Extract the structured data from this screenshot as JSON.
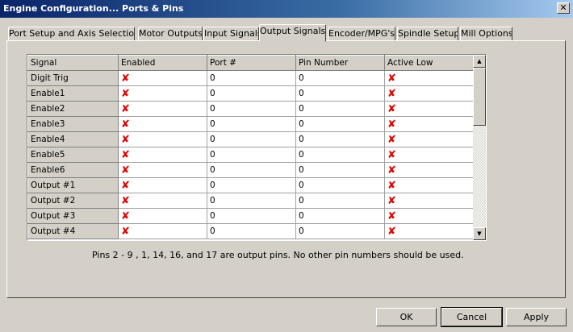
{
  "window": {
    "title": "Engine Configuration... Ports & Pins",
    "close_glyph": "✕"
  },
  "tabs": [
    {
      "label": "Port Setup and Axis Selection",
      "active": false
    },
    {
      "label": "Motor Outputs",
      "active": false
    },
    {
      "label": "Input Signals",
      "active": false
    },
    {
      "label": "Output Signals",
      "active": true
    },
    {
      "label": "Encoder/MPG's",
      "active": false
    },
    {
      "label": "Spindle Setup",
      "active": false
    },
    {
      "label": "Mill Options",
      "active": false
    }
  ],
  "grid": {
    "columns": [
      "Signal",
      "Enabled",
      "Port #",
      "Pin Number",
      "Active Low"
    ],
    "rows": [
      {
        "signal": "Digit  Trig",
        "enabled": "✘",
        "port": "0",
        "pin": "0",
        "active_low": "✘"
      },
      {
        "signal": "Enable1",
        "enabled": "✘",
        "port": "0",
        "pin": "0",
        "active_low": "✘"
      },
      {
        "signal": "Enable2",
        "enabled": "✘",
        "port": "0",
        "pin": "0",
        "active_low": "✘"
      },
      {
        "signal": "Enable3",
        "enabled": "✘",
        "port": "0",
        "pin": "0",
        "active_low": "✘"
      },
      {
        "signal": "Enable4",
        "enabled": "✘",
        "port": "0",
        "pin": "0",
        "active_low": "✘"
      },
      {
        "signal": "Enable5",
        "enabled": "✘",
        "port": "0",
        "pin": "0",
        "active_low": "✘"
      },
      {
        "signal": "Enable6",
        "enabled": "✘",
        "port": "0",
        "pin": "0",
        "active_low": "✘"
      },
      {
        "signal": "Output #1",
        "enabled": "✘",
        "port": "0",
        "pin": "0",
        "active_low": "✘"
      },
      {
        "signal": "Output #2",
        "enabled": "✘",
        "port": "0",
        "pin": "0",
        "active_low": "✘"
      },
      {
        "signal": "Output #3",
        "enabled": "✘",
        "port": "0",
        "pin": "0",
        "active_low": "✘"
      },
      {
        "signal": "Output #4",
        "enabled": "✘",
        "port": "0",
        "pin": "0",
        "active_low": "✘"
      }
    ],
    "scroll_up_glyph": "▲",
    "scroll_down_glyph": "▼"
  },
  "hint_text": "Pins 2 - 9 , 1, 14, 16, and 17 are output pins. No  other pin numbers should be used.",
  "buttons": {
    "ok": "OK",
    "cancel": "Cancel",
    "apply": "Apply"
  },
  "colors": {
    "title_bar": "#0a246a",
    "x_mark": "#e00000",
    "face": "#d4d0c8"
  }
}
